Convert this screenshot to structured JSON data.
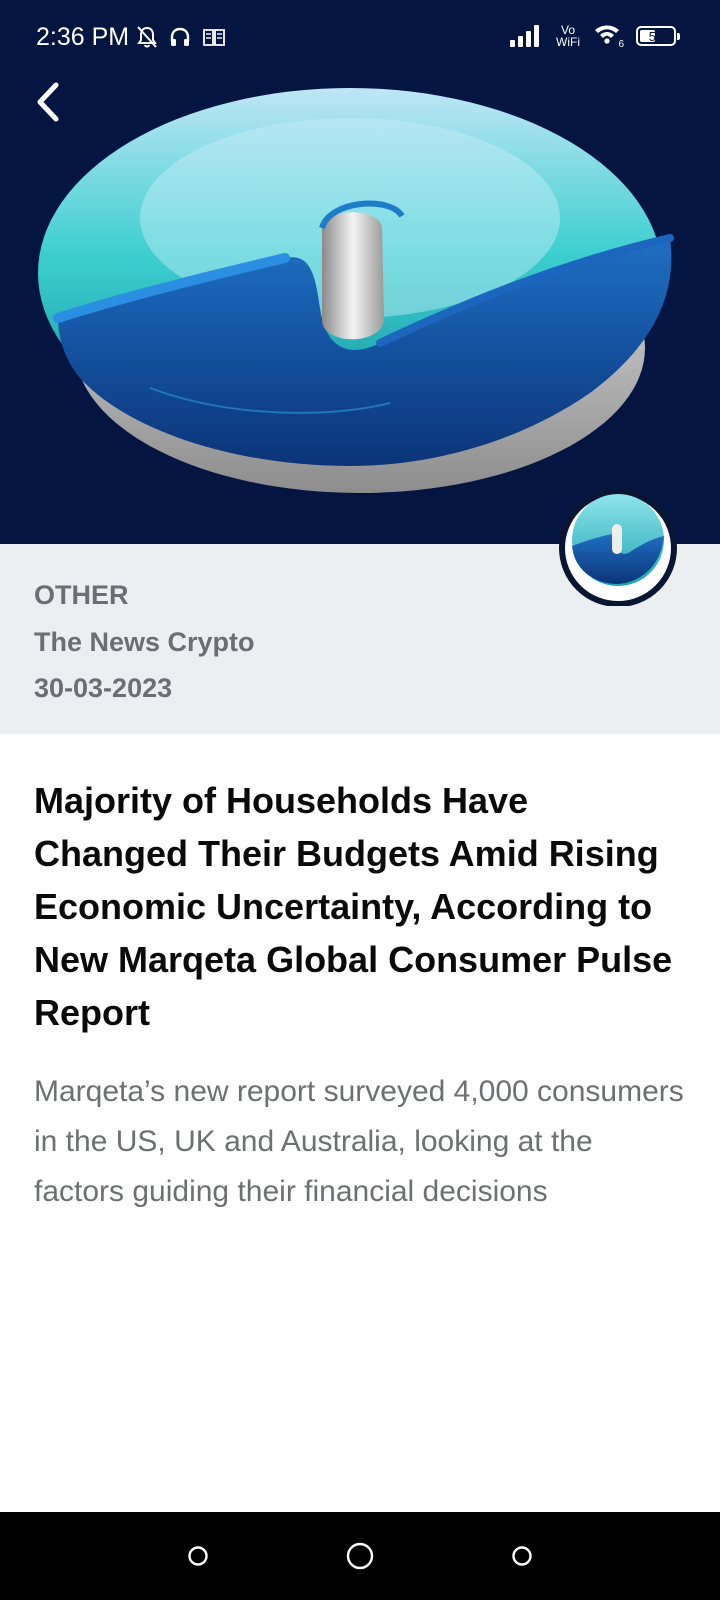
{
  "status_bar": {
    "time": "2:36 PM",
    "vowifi_top": "Vo",
    "vowifi_bottom": "WiFi",
    "wifi_sub": "6",
    "battery_level": "53",
    "battery_fraction": 0.53
  },
  "icons": {
    "back": "chevron-left-icon",
    "mute": "bell-off-icon",
    "headset": "headphones-icon",
    "reader": "book-icon",
    "signal": "signal-icon",
    "wifi": "wifi-icon",
    "battery": "battery-icon"
  },
  "article": {
    "category": "OTHER",
    "source": "The News Crypto",
    "date": "30-03-2023",
    "headline": "Majority of Households Have Changed Their Budgets Amid Rising Economic Uncertainty, According to New Marqeta Global Consumer Pulse Report",
    "summary": "Marqeta’s new report surveyed 4,000 consumers in the US, UK and Australia, looking at the factors guiding their financial decisions"
  },
  "colors": {
    "hero_background": "#031540",
    "meta_background": "#eceff1",
    "meta_text": "#6b6f73",
    "headline_text": "#0a0a0a",
    "summary_text": "#6d6f72",
    "nav_background": "#000000"
  }
}
